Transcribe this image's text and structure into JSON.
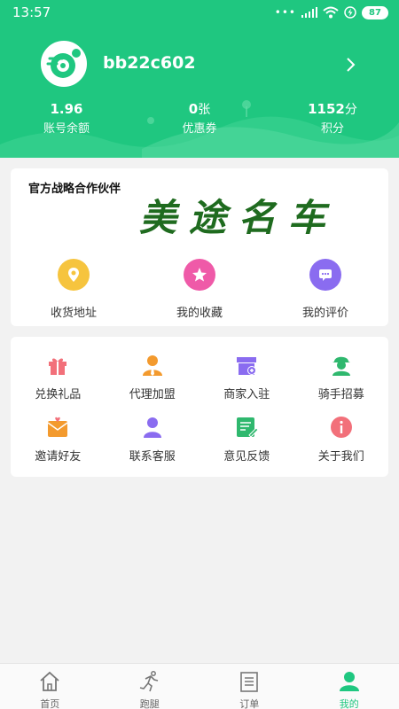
{
  "status_bar": {
    "time": "13:57",
    "battery": "87"
  },
  "profile": {
    "username": "bb22c602"
  },
  "stats": [
    {
      "value": "1.96",
      "unit": "",
      "label": "账号余额"
    },
    {
      "value": "0",
      "unit": "张",
      "label": "优惠券"
    },
    {
      "value": "1152",
      "unit": "分",
      "label": "积分"
    }
  ],
  "partner": {
    "title": "官方战略合作伙伴",
    "logo_text": "美途名车"
  },
  "quick_actions": [
    {
      "label": "收货地址",
      "icon": "location-icon",
      "color": "#f6c43e"
    },
    {
      "label": "我的收藏",
      "icon": "star-icon",
      "color": "#ef5aa8"
    },
    {
      "label": "我的评价",
      "icon": "comment-icon",
      "color": "#8a6cf0"
    }
  ],
  "services": [
    {
      "label": "兑换礼品",
      "icon": "gift-icon"
    },
    {
      "label": "代理加盟",
      "icon": "agent-icon"
    },
    {
      "label": "商家入驻",
      "icon": "store-icon"
    },
    {
      "label": "骑手招募",
      "icon": "rider-icon"
    },
    {
      "label": "邀请好友",
      "icon": "invite-icon"
    },
    {
      "label": "联系客服",
      "icon": "service-icon"
    },
    {
      "label": "意见反馈",
      "icon": "feedback-icon"
    },
    {
      "label": "关于我们",
      "icon": "info-icon"
    }
  ],
  "bottom_nav": [
    {
      "label": "首页",
      "icon": "home-icon"
    },
    {
      "label": "跑腿",
      "icon": "errand-icon"
    },
    {
      "label": "订单",
      "icon": "order-icon"
    },
    {
      "label": "我的",
      "icon": "profile-icon",
      "active": true
    }
  ],
  "colors": {
    "brand": "#1fc780",
    "logo": "#1f6b1f"
  }
}
